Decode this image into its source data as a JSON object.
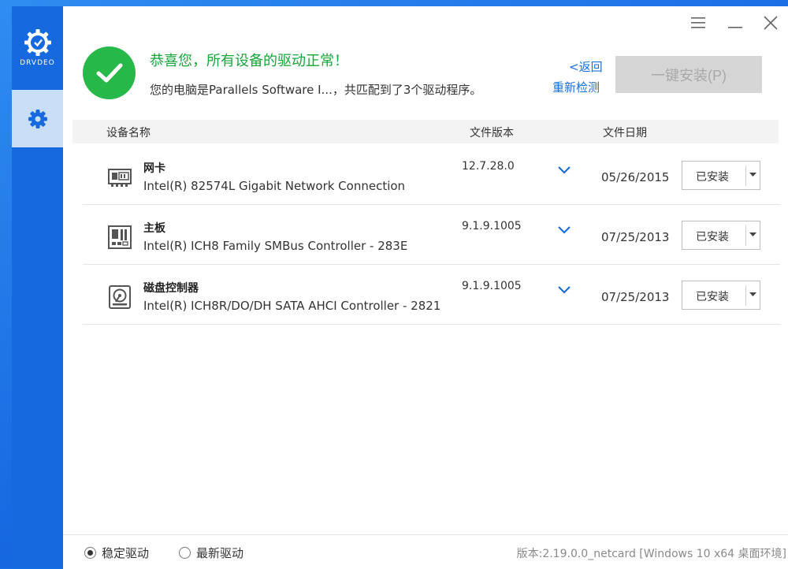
{
  "app": {
    "logo_text": "DRVDEO"
  },
  "header": {
    "title": "恭喜您，所有设备的驱动正常！",
    "subtitle": "您的电脑是Parallels Software I...，共匹配到了3个驱动程序。",
    "back_label": "<返回",
    "rescan_label": "重新检测",
    "install_all_label": "一键安装(P)"
  },
  "table": {
    "columns": [
      "设备名称",
      "文件版本",
      "文件日期"
    ],
    "rows": [
      {
        "icon": "network-card-icon",
        "category": "网卡",
        "name": "Intel(R) 82574L Gigabit Network Connection",
        "version": "12.7.28.0",
        "date": "05/26/2015",
        "status": "已安装"
      },
      {
        "icon": "motherboard-icon",
        "category": "主板",
        "name": "Intel(R) ICH8 Family SMBus Controller - 283E",
        "version": "9.1.9.1005",
        "date": "07/25/2013",
        "status": "已安装"
      },
      {
        "icon": "disk-controller-icon",
        "category": "磁盘控制器",
        "name": "Intel(R) ICH8R/DO/DH SATA AHCI Controller - 2821",
        "version": "9.1.9.1005",
        "date": "07/25/2013",
        "status": "已安装"
      }
    ]
  },
  "footer": {
    "radio_stable": "稳定驱动",
    "radio_latest": "最新驱动",
    "selected": "稳定驱动",
    "version_info": "版本:2.19.0.0_netcard [Windows 10 x64 桌面环境]"
  },
  "colors": {
    "accent": "#1769e0",
    "success": "#27b84a",
    "link": "#1a6fd8",
    "disabled_button": "#d6d6d6"
  }
}
